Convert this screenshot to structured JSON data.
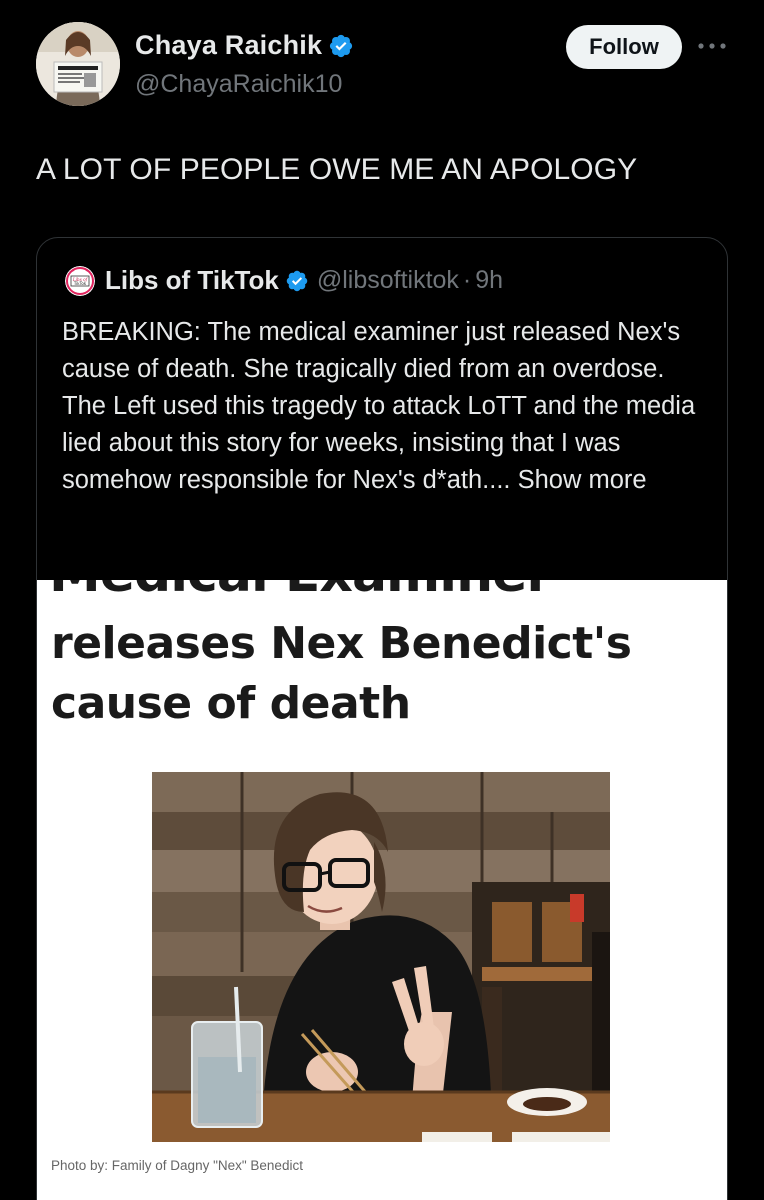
{
  "author": {
    "name": "Chaya Raichik",
    "handle": "@ChayaRaichik10",
    "avatar_icon": "profile-photo"
  },
  "follow_label": "Follow",
  "more_icon": "ellipsis-icon",
  "tweet_text": "A LOT OF PEOPLE OWE ME AN APOLOGY",
  "quoted": {
    "name": "Libs of TikTok",
    "handle": "@libsoftiktok",
    "separator": "·",
    "time": "9h",
    "logo_text": "Libs of TikTok",
    "paragraph1": "BREAKING: The medical examiner just released Nex's cause of death. She tragically died from an overdose.",
    "paragraph2": "The Left used this tragedy to attack LoTT and the media lied about this story for weeks, insisting that I was somehow responsible for Nex's d*ath....",
    "show_more": "Show more"
  },
  "article": {
    "cut_headline": "Medical Examiner",
    "headline": "releases Nex Benedict's cause of death",
    "caption": "Photo by: Family of Dagny \"Nex\" Benedict"
  },
  "colors": {
    "background": "#000000",
    "verified": "#1d9bf0",
    "muted": "#71767b",
    "follow_bg": "#eff3f4"
  }
}
